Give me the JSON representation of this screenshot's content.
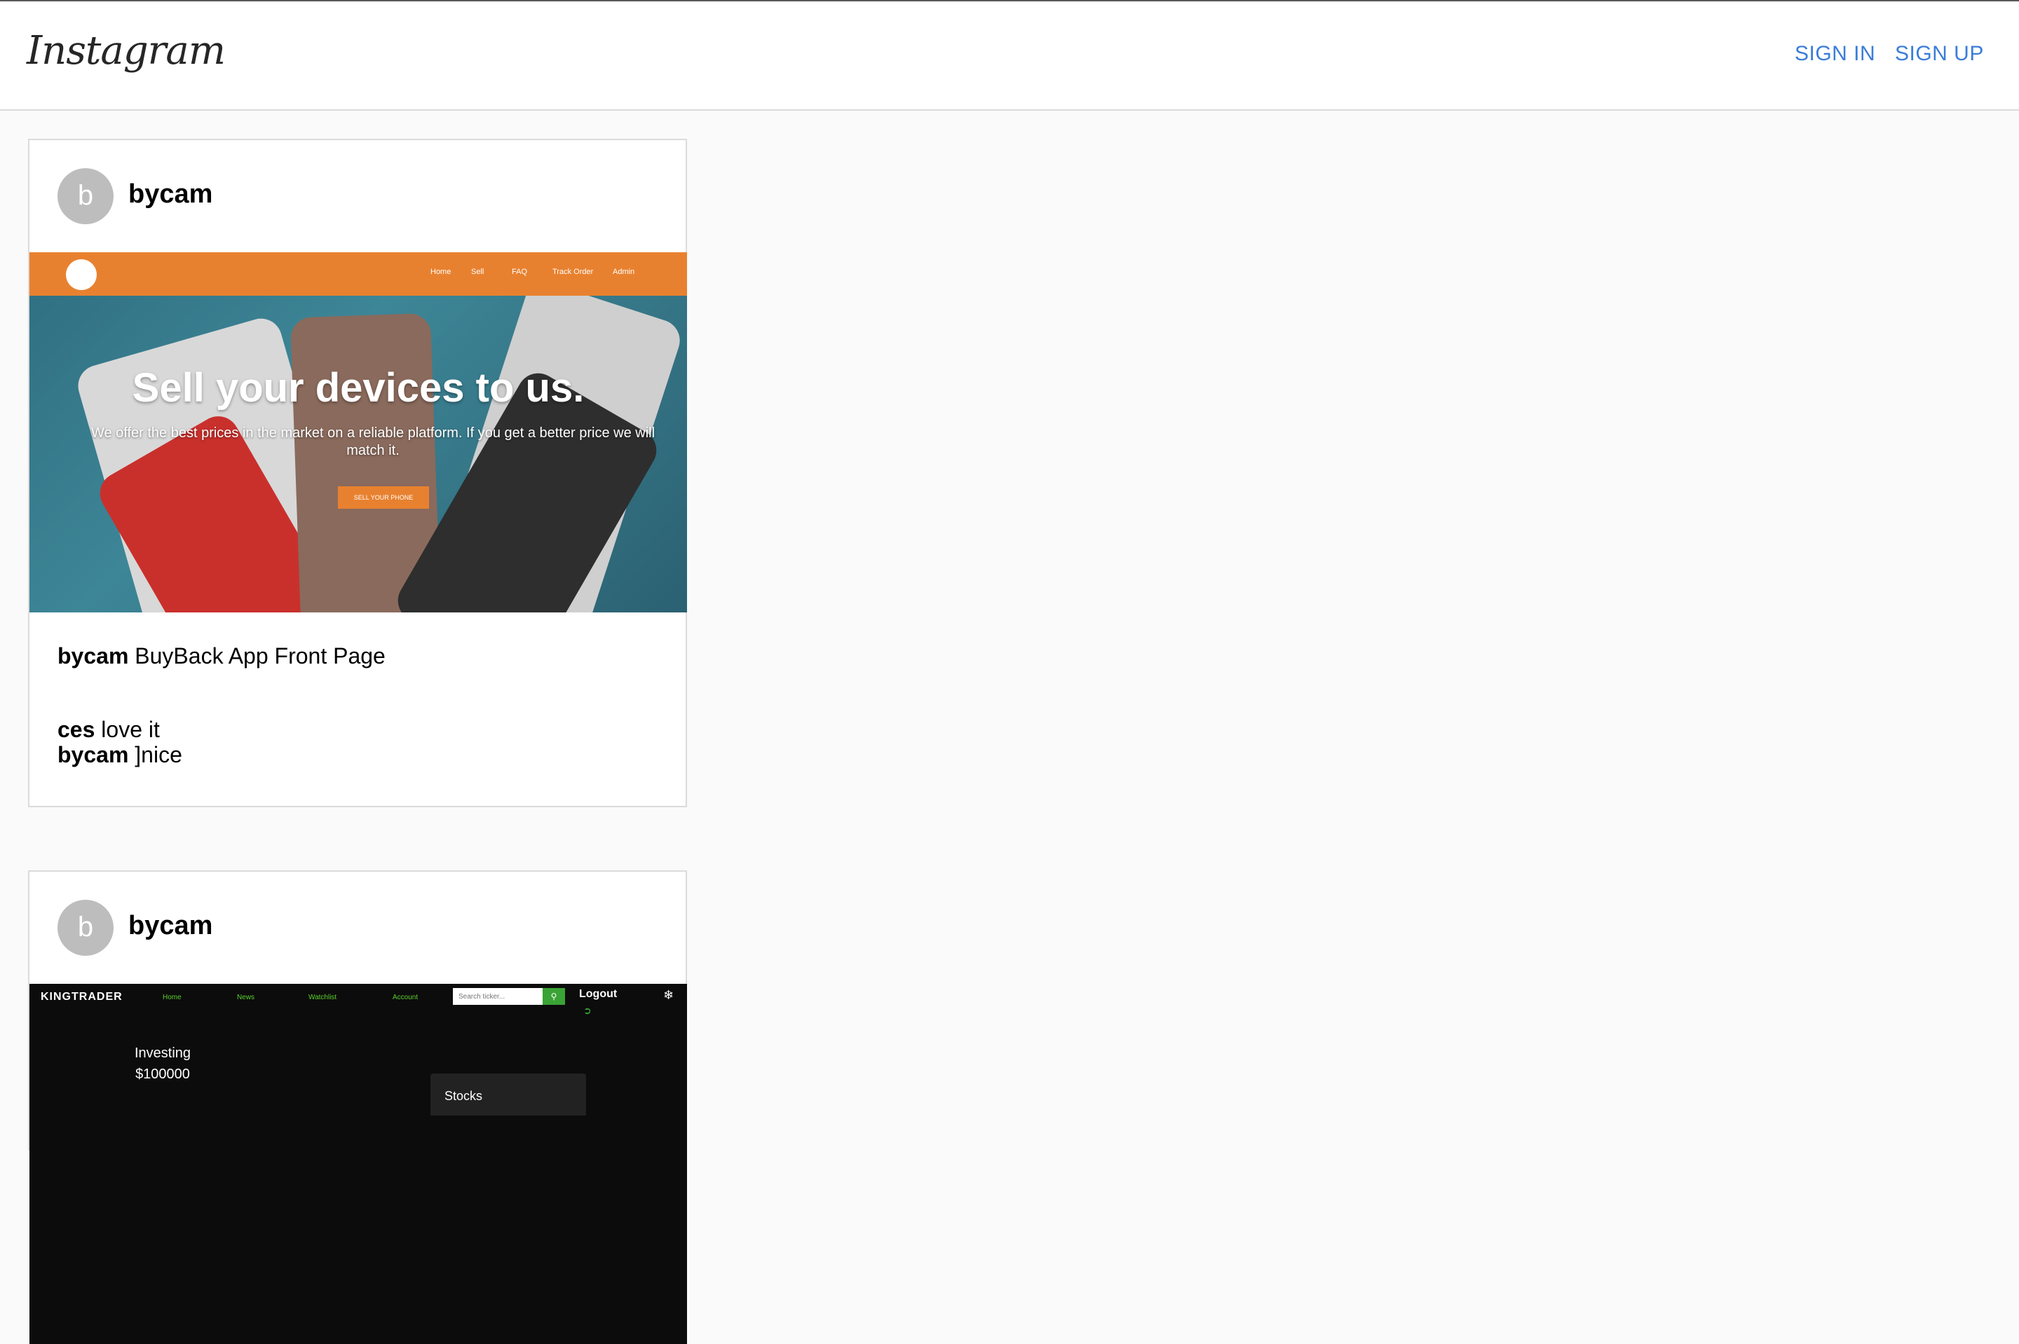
{
  "header": {
    "logo_text": "Instagram",
    "sign_in": "SIGN IN",
    "sign_up": "SIGN UP"
  },
  "posts": [
    {
      "avatar_letter": "b",
      "username": "bycam",
      "image": {
        "nav_items": [
          "Home",
          "Sell",
          "FAQ",
          "Track Order",
          "Admin"
        ],
        "hero_title": "Sell your devices to us.",
        "hero_subtitle": "We offer the best prices in the market on a reliable platform. If you get a better price we will match it.",
        "hero_button": "SELL YOUR PHONE"
      },
      "caption_user": "bycam",
      "caption_text": "BuyBack App Front Page",
      "comments": [
        {
          "user": "ces",
          "text": "love it"
        },
        {
          "user": "bycam",
          "text": "]nice"
        }
      ]
    },
    {
      "avatar_letter": "b",
      "username": "bycam",
      "image": {
        "logo": "KINGTRADER",
        "nav_items": [
          "Home",
          "News",
          "Watchlist",
          "Account"
        ],
        "search_placeholder": "Search ticker...",
        "logout": "Logout",
        "investing_label": "Investing",
        "investing_value": "$100000",
        "stocks_label": "Stocks"
      }
    }
  ],
  "colors": {
    "link": "#3b7dd8",
    "accent_orange": "#e8812f",
    "kt_green": "#5bd02a"
  }
}
